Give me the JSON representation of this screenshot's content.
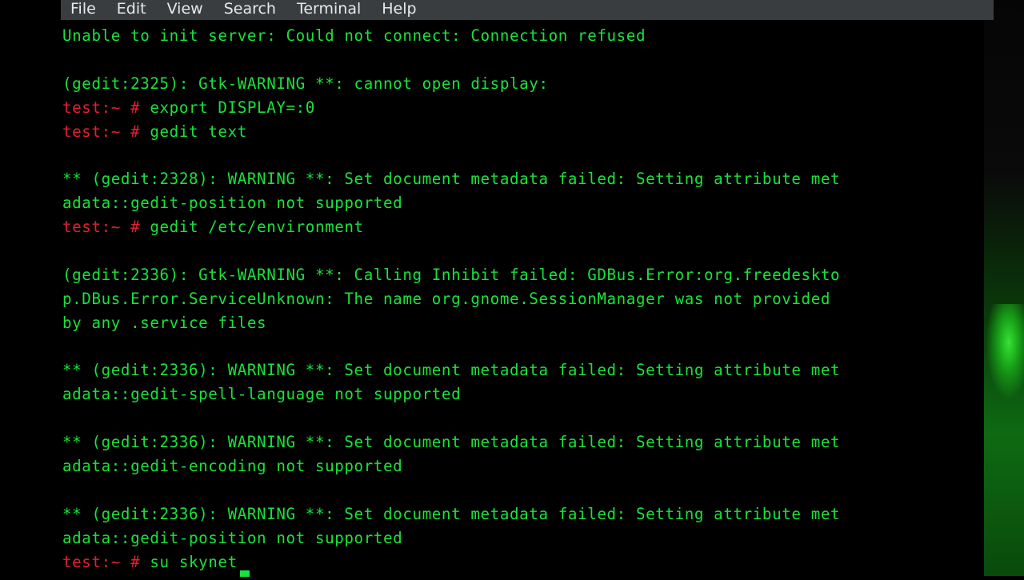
{
  "window": {
    "menu": [
      "File",
      "Edit",
      "View",
      "Search",
      "Terminal",
      "Help"
    ]
  },
  "colors": {
    "output_text": "#19e23a",
    "prompt": "#e0202e",
    "background": "#000000",
    "menubar": "#3a3d40"
  },
  "terminal": {
    "lines": [
      {
        "type": "output",
        "text": "Unable to init server: Could not connect: Connection refused"
      },
      {
        "type": "blank",
        "text": ""
      },
      {
        "type": "output",
        "text": "(gedit:2325): Gtk-WARNING **: cannot open display:"
      },
      {
        "type": "command",
        "prompt": "test:~ #",
        "text": " export DISPLAY=:0"
      },
      {
        "type": "command",
        "prompt": "test:~ #",
        "text": " gedit text"
      },
      {
        "type": "blank",
        "text": ""
      },
      {
        "type": "output",
        "text": "** (gedit:2328): WARNING **: Set document metadata failed: Setting attribute met"
      },
      {
        "type": "output",
        "text": "adata::gedit-position not supported"
      },
      {
        "type": "command",
        "prompt": "test:~ #",
        "text": " gedit /etc/environment"
      },
      {
        "type": "blank",
        "text": ""
      },
      {
        "type": "output",
        "text": "(gedit:2336): Gtk-WARNING **: Calling Inhibit failed: GDBus.Error:org.freedeskto"
      },
      {
        "type": "output",
        "text": "p.DBus.Error.ServiceUnknown: The name org.gnome.SessionManager was not provided"
      },
      {
        "type": "output",
        "text": "by any .service files"
      },
      {
        "type": "blank",
        "text": ""
      },
      {
        "type": "output",
        "text": "** (gedit:2336): WARNING **: Set document metadata failed: Setting attribute met"
      },
      {
        "type": "output",
        "text": "adata::gedit-spell-language not supported"
      },
      {
        "type": "blank",
        "text": ""
      },
      {
        "type": "output",
        "text": "** (gedit:2336): WARNING **: Set document metadata failed: Setting attribute met"
      },
      {
        "type": "output",
        "text": "adata::gedit-encoding not supported"
      },
      {
        "type": "blank",
        "text": ""
      },
      {
        "type": "output",
        "text": "** (gedit:2336): WARNING **: Set document metadata failed: Setting attribute met"
      },
      {
        "type": "output",
        "text": "adata::gedit-position not supported"
      },
      {
        "type": "command",
        "prompt": "test:~ #",
        "text": " su skynet"
      }
    ]
  }
}
